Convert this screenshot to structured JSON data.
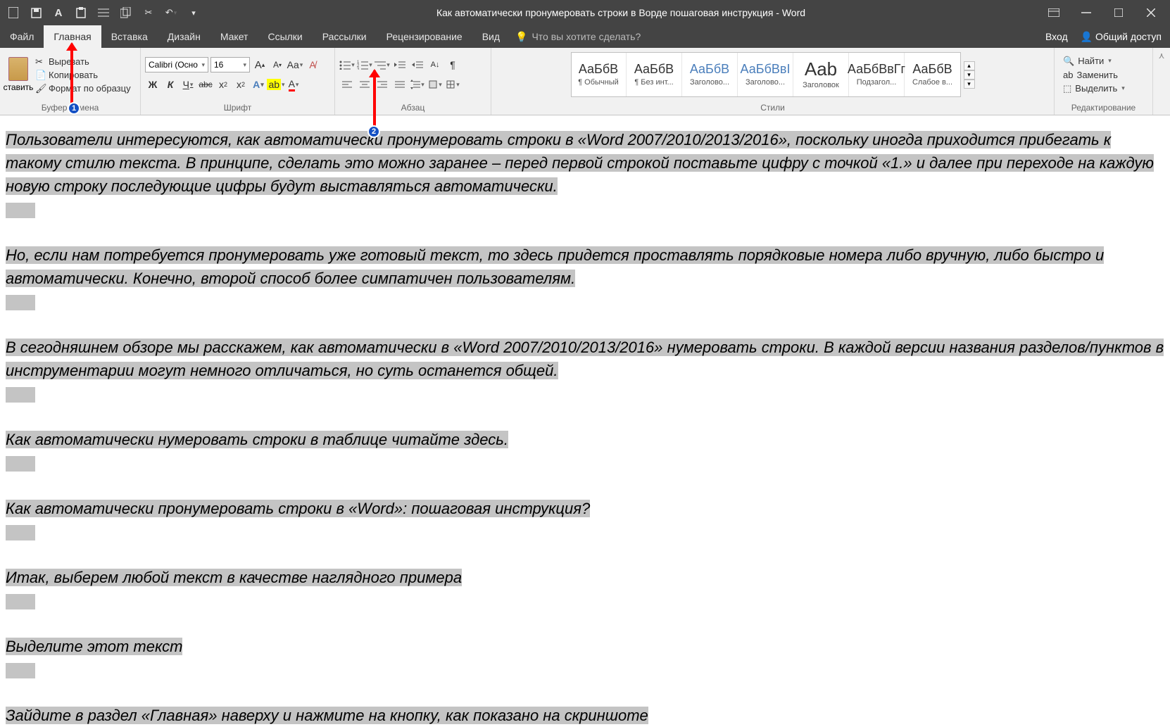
{
  "title": "Как автоматически пронумеровать строки в Ворде пошаговая инструкция - Word",
  "tabs": {
    "file": "Файл",
    "home": "Главная",
    "insert": "Вставка",
    "design": "Дизайн",
    "layout": "Макет",
    "references": "Ссылки",
    "mailings": "Рассылки",
    "review": "Рецензирование",
    "view": "Вид",
    "tellme": "Что вы хотите сделать?",
    "signin": "Вход",
    "share": "Общий доступ"
  },
  "clipboard": {
    "paste": "ставить",
    "cut": "Вырезать",
    "copy": "Копировать",
    "format": "Формат по образцу",
    "group": "Буфер обмена"
  },
  "font": {
    "name": "Calibri (Осно",
    "size": "16",
    "group": "Шрифт"
  },
  "paragraph": {
    "group": "Абзац"
  },
  "styles": {
    "group": "Стили",
    "items": [
      {
        "prev": "АаБбВ",
        "lbl": "¶ Обычный",
        "cls": ""
      },
      {
        "prev": "АаБбВ",
        "lbl": "¶ Без инт...",
        "cls": ""
      },
      {
        "prev": "АаБбВ",
        "lbl": "Заголово...",
        "cls": "blue"
      },
      {
        "prev": "АаБбВвІ",
        "lbl": "Заголово...",
        "cls": "blue"
      },
      {
        "prev": "Aab",
        "lbl": "Заголовок",
        "cls": "big"
      },
      {
        "prev": "АаБбВвГг",
        "lbl": "Подзагол...",
        "cls": ""
      },
      {
        "prev": "АаБбВ",
        "lbl": "Слабое в...",
        "cls": ""
      }
    ]
  },
  "editing": {
    "find": "Найти",
    "replace": "Заменить",
    "select": "Выделить",
    "group": "Редактирование"
  },
  "badges": {
    "b1": "1",
    "b2": "2"
  },
  "doc": {
    "p1": "Пользователи интересуются, как автоматически пронумеровать строки в «Word 2007/2010/2013/2016», поскольку иногда приходится прибегать к такому стилю текста. В принципе, сделать это можно заранее – перед первой строкой поставьте цифру с точкой «1.» и далее при переходе на каждую новую строку последующие цифры будут выставляться автоматически.",
    "p2": "Но, если нам потребуется пронумеровать уже готовый текст, то здесь придется проставлять порядковые номера либо вручную, либо быстро и автоматически. Конечно, второй способ более симпатичен пользователям.",
    "p3": "В сегодняшнем обзоре мы расскажем, как автоматически в «Word 2007/2010/2013/2016» нумеровать строки. В каждой версии названия разделов/пунктов в инструментарии могут немного отличаться, но суть останется общей.",
    "p4": "Как автоматически нумеровать строки в таблице читайте здесь.",
    "p5": "Как автоматически пронумеровать строки в «Word»: пошаговая инструкция?",
    "p6": "Итак, выберем любой текст в качестве наглядного примера",
    "p7": "Выделите этот текст",
    "p8": "Зайдите в раздел «Главная» наверху и нажмите на кнопку, как показано на скриншоте"
  }
}
